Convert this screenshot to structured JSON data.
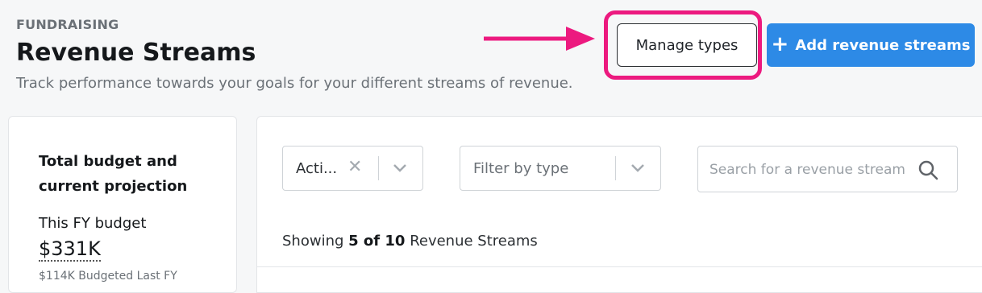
{
  "header": {
    "eyebrow": "FUNDRAISING",
    "title": "Revenue Streams",
    "subtitle": "Track performance towards your goals for your different streams of revenue."
  },
  "actions": {
    "manage_types": "Manage types",
    "add_revenue_streams": "Add revenue streams",
    "highlight_color": "#ec1a7f",
    "primary_color": "#2d8ae6"
  },
  "summary": {
    "heading": "Total budget and current projection",
    "this_fy_label": "This FY budget",
    "this_fy_value": "$331K",
    "last_fy_note": "$114K Budgeted Last FY"
  },
  "filters": {
    "status_value": "Acti...",
    "type_placeholder": "Filter by type",
    "search_placeholder": "Search for a revenue stream"
  },
  "results": {
    "prefix": "Showing",
    "count": "5 of 10",
    "suffix": "Revenue Streams"
  }
}
